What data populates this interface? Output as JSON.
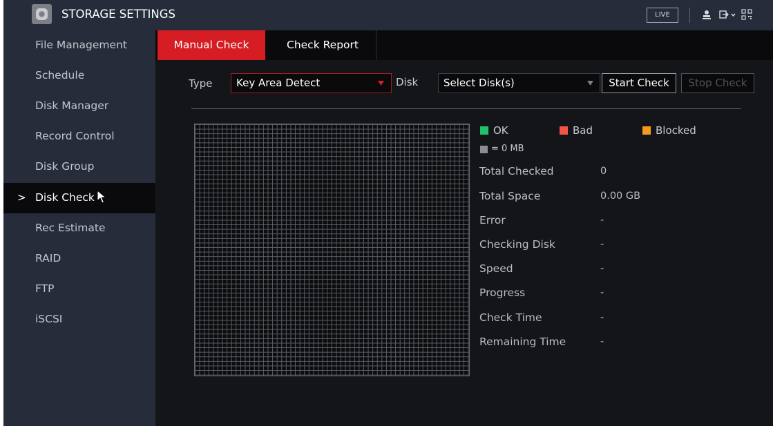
{
  "window": {
    "title": "STORAGE SETTINGS",
    "live_label": "LIVE",
    "user_icon": "user-icon",
    "logout_icon": "logout-icon",
    "qr_icon": "qr-code-icon"
  },
  "sidebar": {
    "items": [
      {
        "label": "File Management"
      },
      {
        "label": "Schedule"
      },
      {
        "label": "Disk Manager"
      },
      {
        "label": "Record Control"
      },
      {
        "label": "Disk Group"
      },
      {
        "label": "Disk Check"
      },
      {
        "label": "Rec Estimate"
      },
      {
        "label": "RAID"
      },
      {
        "label": "FTP"
      },
      {
        "label": "iSCSI"
      }
    ],
    "active_marker": ">"
  },
  "tabs": [
    {
      "label": "Manual Check"
    },
    {
      "label": "Check Report"
    }
  ],
  "toolbar": {
    "type_label": "Type",
    "type_value": "Key Area Detect",
    "disk_label": "Disk",
    "disk_value": "Select Disk(s)",
    "start_label": "Start Check",
    "stop_label": "Stop Check"
  },
  "legend": {
    "ok": "OK",
    "bad": "Bad",
    "blocked": "Blocked",
    "unit": "= 0 MB",
    "colors": {
      "ok": "#20c36a",
      "bad": "#f25545",
      "blocked": "#f59a1e",
      "unit": "#8a8d94"
    }
  },
  "info": [
    {
      "label": "Total Checked",
      "value": "0"
    },
    {
      "label": "Total Space",
      "value": "0.00 GB"
    },
    {
      "label": "Error",
      "value": "-"
    },
    {
      "label": "Checking Disk",
      "value": "-"
    },
    {
      "label": "Speed",
      "value": "-"
    },
    {
      "label": "Progress",
      "value": "-"
    },
    {
      "label": "Check Time",
      "value": "-"
    },
    {
      "label": "Remaining Time",
      "value": "-"
    }
  ],
  "colors": {
    "accent": "#d61d24",
    "sidebar_bg": "#262c3a",
    "content_bg": "#141518"
  }
}
